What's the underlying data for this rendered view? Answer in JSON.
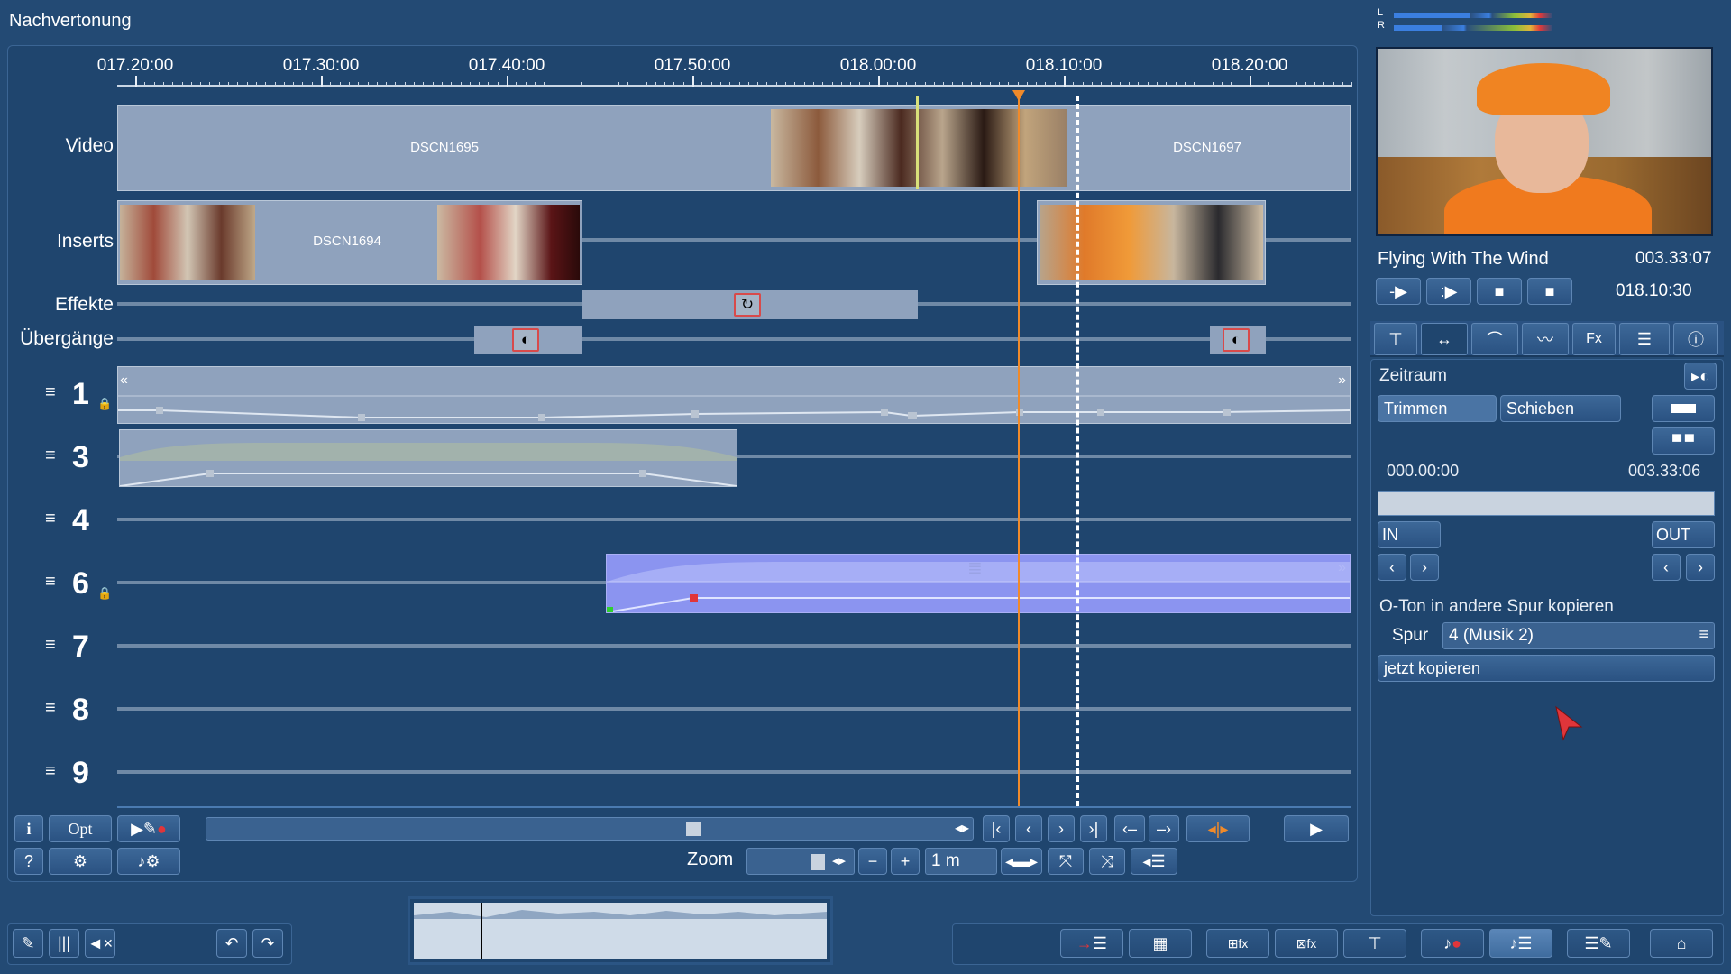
{
  "app": {
    "title": "Nachvertonung"
  },
  "ruler": {
    "labels": [
      "017.20:00",
      "017.30:00",
      "017.40:00",
      "017.50:00",
      "018.00:00",
      "018.10:00",
      "018.20:00"
    ]
  },
  "tracks": {
    "video": {
      "label": "Video",
      "clips": [
        "DSCN1695",
        "DSCN1697"
      ]
    },
    "inserts": {
      "label": "Inserts",
      "clips": [
        "DSCN1694"
      ]
    },
    "effects": {
      "label": "Effekte"
    },
    "transitions": {
      "label": "Übergänge"
    },
    "audio": [
      {
        "number": "1",
        "locked": true
      },
      {
        "number": "3",
        "locked": false
      },
      {
        "number": "4",
        "locked": false
      },
      {
        "number": "6",
        "locked": true
      },
      {
        "number": "7",
        "locked": false
      },
      {
        "number": "8",
        "locked": false
      },
      {
        "number": "9",
        "locked": false
      }
    ],
    "scroll_left": "«",
    "scroll_right": "»"
  },
  "toolbar": {
    "info": "i",
    "opt": "Opt",
    "help": "?",
    "zoom_label": "Zoom",
    "zoom_value": "1 m",
    "minus": "−",
    "plus": "+"
  },
  "preview": {
    "title": "Flying With The Wind",
    "duration": "003.33:07",
    "position": "018.10:30"
  },
  "meters": {
    "left": "L",
    "right": "R"
  },
  "panel": {
    "section": "Zeitraum",
    "trim_label": "Trimmen",
    "shift_label": "Schieben",
    "start_time": "000.00:00",
    "end_time": "003.33:06",
    "in_label": "IN",
    "out_label": "OUT",
    "copy_heading": "O-Ton in andere Spur kopieren",
    "track_label": "Spur",
    "track_value": "4 (Musik 2)",
    "copy_button": "jetzt kopieren",
    "fx_tab": "Fx"
  },
  "colors": {
    "background": "#234a74",
    "playhead": "#f08a2a",
    "selected_audio": "#8b94f0",
    "clip": "#8fa2bd"
  }
}
